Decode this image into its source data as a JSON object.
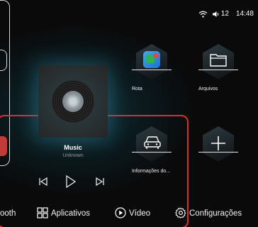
{
  "status_bar": {
    "time": "14:48",
    "volume": "12",
    "icons": [
      "wifi-icon",
      "volume-icon"
    ]
  },
  "music": {
    "title": "Music",
    "artist": "Unknown",
    "controls": [
      "previous-icon",
      "play-icon",
      "next-icon"
    ]
  },
  "apps": [
    {
      "label": "Rota",
      "icon": "maps-icon"
    },
    {
      "label": "Arquivos",
      "icon": "folder-icon"
    },
    {
      "label": "Informações do...",
      "icon": "car-icon"
    },
    {
      "label": "",
      "icon": "add-icon"
    }
  ],
  "nav": {
    "bluetooth": "ooth",
    "apps": "Aplicativos",
    "video": "Vídeo",
    "settings": "Configurações"
  },
  "colors": {
    "highlight": "#d8302f",
    "background": "#0a0a0b",
    "accent": "#1f8fe0"
  }
}
